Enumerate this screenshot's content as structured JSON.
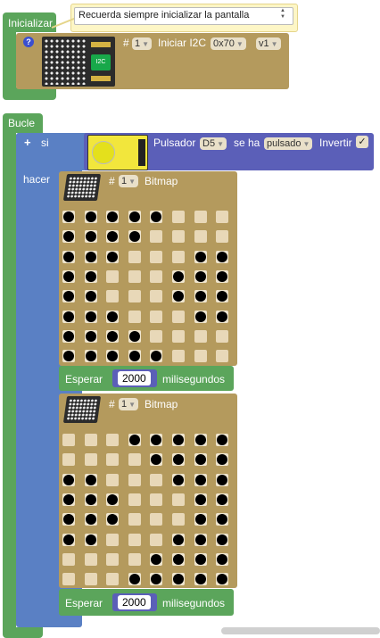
{
  "init": {
    "title": "Inicializar",
    "comment": "Recuerda siempre inicializar la pantalla",
    "hash": "#",
    "index": "1",
    "label": "Iniciar I2C",
    "address": "0x70",
    "version": "v1",
    "help_glyph": "?",
    "chip_label": "I2C"
  },
  "loop": {
    "title": "Bucle",
    "plus": "+",
    "si": "si",
    "hacer": "hacer",
    "button_label": "Pulsador",
    "pin": "D5",
    "se_ha": "se ha",
    "state": "pulsado",
    "invert_label": "Invertir",
    "check": "✓"
  },
  "bitmaps": [
    {
      "hash": "#",
      "index": "1",
      "label": "Bitmap",
      "grid": [
        [
          1,
          1,
          1,
          1,
          1,
          0,
          0,
          0
        ],
        [
          1,
          1,
          1,
          1,
          0,
          0,
          0,
          0
        ],
        [
          1,
          1,
          1,
          0,
          0,
          0,
          1,
          1
        ],
        [
          1,
          1,
          0,
          0,
          0,
          1,
          1,
          1
        ],
        [
          1,
          1,
          0,
          0,
          0,
          1,
          1,
          1
        ],
        [
          1,
          1,
          1,
          0,
          0,
          0,
          1,
          1
        ],
        [
          1,
          1,
          1,
          1,
          0,
          0,
          0,
          0
        ],
        [
          1,
          1,
          1,
          1,
          1,
          0,
          0,
          0
        ]
      ]
    },
    {
      "hash": "#",
      "index": "1",
      "label": "Bitmap",
      "grid": [
        [
          0,
          0,
          0,
          1,
          1,
          1,
          1,
          1
        ],
        [
          0,
          0,
          0,
          0,
          1,
          1,
          1,
          1
        ],
        [
          1,
          1,
          0,
          0,
          0,
          1,
          1,
          1
        ],
        [
          1,
          1,
          1,
          0,
          0,
          0,
          1,
          1
        ],
        [
          1,
          1,
          1,
          0,
          0,
          0,
          1,
          1
        ],
        [
          1,
          1,
          0,
          0,
          0,
          1,
          1,
          1
        ],
        [
          0,
          0,
          0,
          0,
          1,
          1,
          1,
          1
        ],
        [
          0,
          0,
          0,
          1,
          1,
          1,
          1,
          1
        ]
      ]
    }
  ],
  "waits": [
    {
      "label": "Esperar",
      "value": "2000",
      "unit": "milisegundos"
    },
    {
      "label": "Esperar",
      "value": "2000",
      "unit": "milisegundos"
    }
  ],
  "colors": {
    "green": "#5ba55b",
    "olive": "#b49a5d",
    "blue": "#5a80c4",
    "purple": "#5b5fb8"
  }
}
